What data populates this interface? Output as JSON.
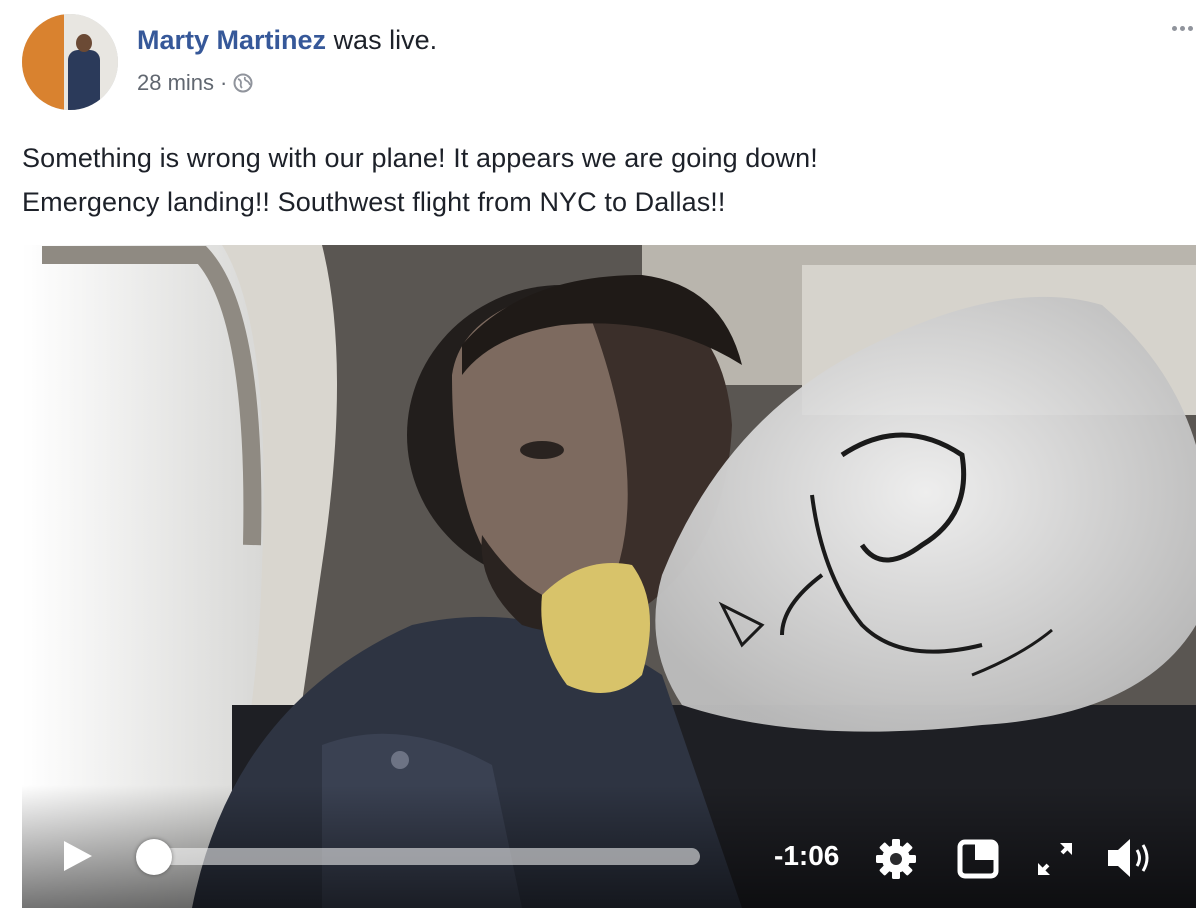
{
  "post": {
    "author_name": "Marty Martinez",
    "author_action": "was live.",
    "timestamp": "28 mins",
    "separator": "·",
    "privacy_icon": "globe-icon",
    "more_icon": "more-options-icon",
    "text_lines": [
      "Something is wrong with our plane! It appears we are going down!",
      "Emergency landing!! Southwest flight from NYC to Dallas!!"
    ]
  },
  "video": {
    "play_icon": "play-icon",
    "time_remaining": "-1:06",
    "progress_fraction": 0.02,
    "settings_icon": "gear-icon",
    "pip_icon": "picture-in-picture-icon",
    "fullscreen_icon": "fullscreen-icon",
    "volume_icon": "volume-icon"
  },
  "colors": {
    "author_link": "#365899",
    "body_text": "#1d2129",
    "meta_text": "#616770"
  }
}
